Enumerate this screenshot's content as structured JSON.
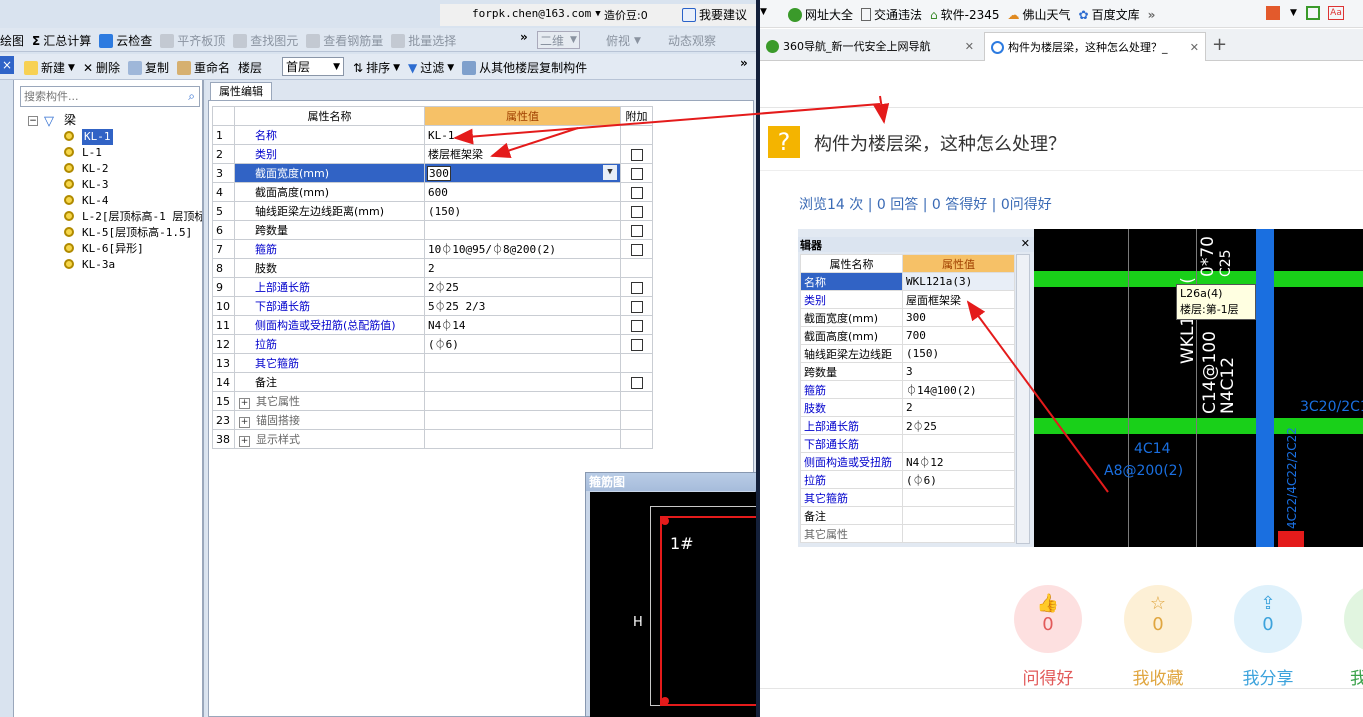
{
  "left_app": {
    "topbar": {
      "email": "forpk.chen@163.com",
      "beans": "造价豆:0",
      "suggest": "我要建议"
    },
    "toolbar1": [
      "绘图",
      "汇总计算",
      "云检查",
      "平齐板顶",
      "查找图元",
      "查看钢筋量",
      "批量选择",
      "二维",
      "俯视",
      "动态观察"
    ],
    "toolbar2": {
      "new": "新建",
      "delete": "删除",
      "copy": "复制",
      "rename": "重命名",
      "floor_label": "楼层",
      "floor_value": "首层",
      "sort": "排序",
      "filter": "过滤",
      "copy_from": "从其他楼层复制构件"
    },
    "search_placeholder": "搜索构件...",
    "tree_root": "梁",
    "tree_items": [
      "KL-1",
      "L-1",
      "KL-2",
      "KL-3",
      "KL-4",
      "L-2[层顶标高-1 层顶标",
      "KL-5[层顶标高-1.5]",
      "KL-6[异形]",
      "KL-3a"
    ],
    "prop_tab": "属性编辑",
    "headers": {
      "name": "属性名称",
      "value": "属性值",
      "extra": "附加"
    },
    "rows": [
      {
        "n": "1",
        "name": "名称",
        "value": "KL-1",
        "cb": false
      },
      {
        "n": "2",
        "name": "类别",
        "value": "楼层框架梁",
        "cb": true
      },
      {
        "n": "3",
        "name": "截面宽度(mm)",
        "value": "300",
        "cb": true
      },
      {
        "n": "4",
        "name": "截面高度(mm)",
        "value": "600",
        "cb": true
      },
      {
        "n": "5",
        "name": "轴线距梁左边线距离(mm)",
        "value": "(150)",
        "cb": true
      },
      {
        "n": "6",
        "name": "跨数量",
        "value": "",
        "cb": true
      },
      {
        "n": "7",
        "name": "箍筋",
        "value": "10⏀10@95/⏀8@200(2)",
        "cb": true
      },
      {
        "n": "8",
        "name": "肢数",
        "value": "2",
        "cb": false
      },
      {
        "n": "9",
        "name": "上部通长筋",
        "value": "2⏀25",
        "cb": true
      },
      {
        "n": "10",
        "name": "下部通长筋",
        "value": "5⏀25 2/3",
        "cb": true
      },
      {
        "n": "11",
        "name": "侧面构造或受扭筋(总配筋值)",
        "value": "N4⏀14",
        "cb": true
      },
      {
        "n": "12",
        "name": "拉筋",
        "value": "(⏀6)",
        "cb": true
      },
      {
        "n": "13",
        "name": "其它箍筋",
        "value": "",
        "cb": false
      },
      {
        "n": "14",
        "name": "备注",
        "value": "",
        "cb": true
      },
      {
        "n": "15",
        "name": "其它属性",
        "value": "",
        "cb": false
      },
      {
        "n": "23",
        "name": "锚固搭接",
        "value": "",
        "cb": false
      },
      {
        "n": "38",
        "name": "显示样式",
        "value": "",
        "cb": false
      }
    ],
    "rebar_panel": {
      "title": "箍筋图",
      "label1": "1#",
      "labelH": "H"
    }
  },
  "browser": {
    "bookmarks": [
      "网址大全",
      "交通违法",
      "软件-2345",
      "佛山天气",
      "百度文库"
    ],
    "tabs": [
      "360导航_新一代安全上网导航",
      "构件为楼层梁，这种怎么处理？_"
    ],
    "question_title": "构件为楼层梁，这种怎么处理？",
    "stats": "浏览14 次 | 0 回答 | 0 答得好 | 0问得好",
    "embedded": {
      "panel_title": "辑器",
      "headers": {
        "name": "属性名称",
        "value": "属性值"
      },
      "rows": [
        {
          "name": "名称",
          "value": "WKL121a(3)"
        },
        {
          "name": "类别",
          "value": "屋面框架梁"
        },
        {
          "name": "截面宽度(mm)",
          "value": "300"
        },
        {
          "name": "截面高度(mm)",
          "value": "700"
        },
        {
          "name": "轴线距梁左边线距",
          "value": "(150)"
        },
        {
          "name": "跨数量",
          "value": "3"
        },
        {
          "name": "箍筋",
          "value": "⏀14@100(2)"
        },
        {
          "name": "肢数",
          "value": "2"
        },
        {
          "name": "上部通长筋",
          "value": "2⏀25"
        },
        {
          "name": "下部通长筋",
          "value": ""
        },
        {
          "name": "侧面构造或受扭筋",
          "value": "N4⏀12"
        },
        {
          "name": "拉筋",
          "value": "(⏀6)"
        },
        {
          "name": "其它箍筋",
          "value": ""
        },
        {
          "name": "备注",
          "value": ""
        },
        {
          "name": "其它属性",
          "value": ""
        }
      ],
      "tooltip1": "L26a(4)",
      "tooltip2": "楼层:第-1层",
      "cad_texts": {
        "t1": "WKL121a(",
        "t2": "C14@100",
        "t3": "N4C12",
        "t4": "4C14",
        "t5": "A8@200(2)",
        "t6": "3C20/2C1",
        "t7": "0*70",
        "t8": "C25",
        "t9": "4C22/4C22/2C22"
      }
    },
    "actions": [
      {
        "count": "0",
        "label": "问得好"
      },
      {
        "count": "0",
        "label": "我收藏"
      },
      {
        "count": "0",
        "label": "我分享"
      },
      {
        "count": "",
        "label": "我"
      }
    ]
  }
}
